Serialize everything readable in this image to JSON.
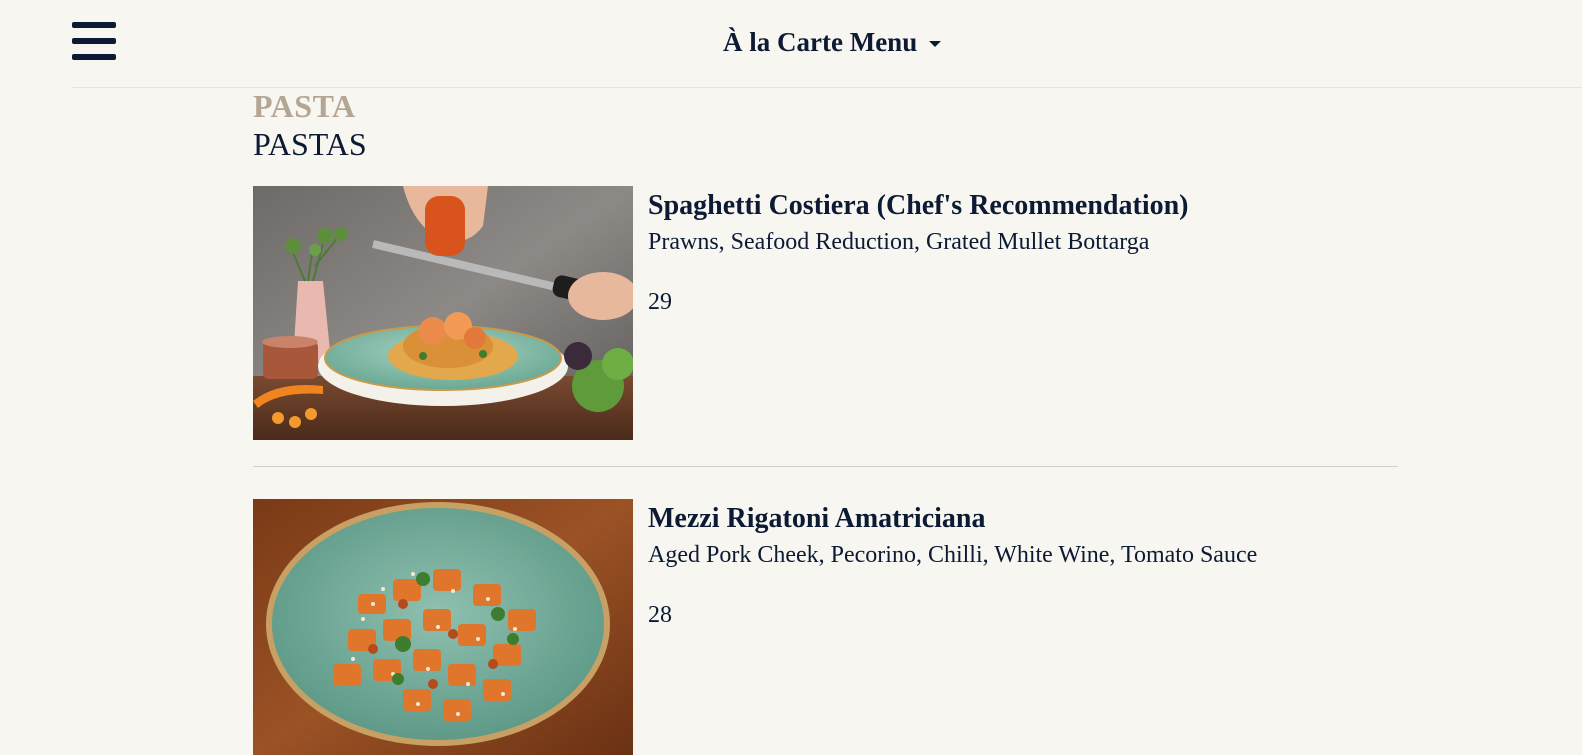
{
  "header": {
    "menu_icon": "hamburger-menu-icon",
    "menu_title": "À la Carte Menu",
    "dropdown_icon": "caret-down-icon"
  },
  "section": {
    "title": "PASTA",
    "subtitle": "PASTAS"
  },
  "items": [
    {
      "name": "Spaghetti Costiera (Chef's Recommendation)",
      "description": "Prawns, Seafood Reduction, Grated Mullet Bottarga",
      "price": "29",
      "image": "spaghetti-with-prawns-photo"
    },
    {
      "name": "Mezzi Rigatoni Amatriciana",
      "description": "Aged Pork Cheek, Pecorino, Chilli, White Wine, Tomato Sauce",
      "price": "28",
      "image": "rigatoni-amatriciana-photo"
    }
  ],
  "colors": {
    "background": "#f7f6f1",
    "text": "#0d1a33",
    "section_accent": "#b5a593"
  }
}
